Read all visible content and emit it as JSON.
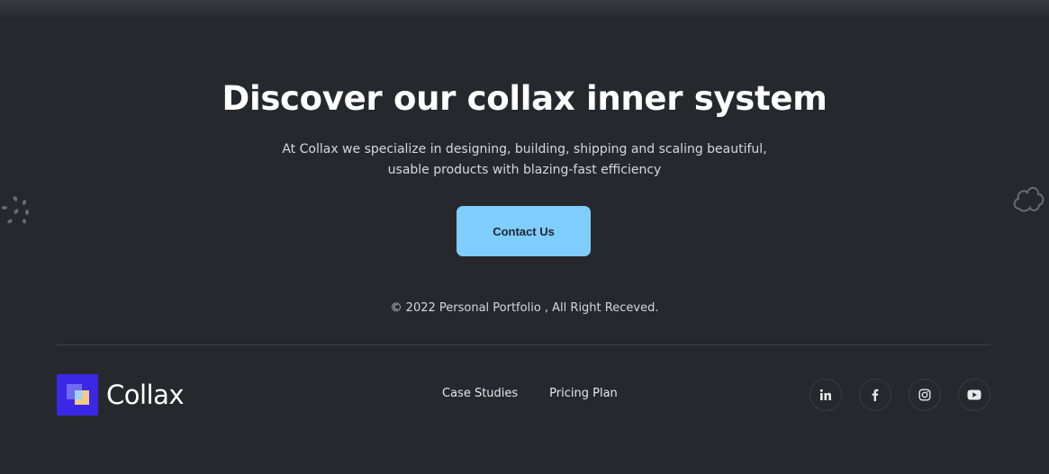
{
  "hero": {
    "title": "Discover our collax inner system",
    "subtitle_line1": "At Collax we specialize in designing, building, shipping and scaling beautiful,",
    "subtitle_line2": "usable products with blazing-fast efficiency",
    "cta_label": "Contact Us"
  },
  "footer": {
    "copyright": "© 2022 Personal Portfolio , All Right Receved.",
    "brand": "Collax",
    "nav": [
      "Case Studies",
      "Pricing Plan"
    ],
    "socials": [
      "linkedin-icon",
      "facebook-icon",
      "instagram-icon",
      "youtube-icon"
    ]
  },
  "colors": {
    "background": "#27282d",
    "accent_button": "#7fcdfc",
    "logo": "#3a28e6"
  }
}
